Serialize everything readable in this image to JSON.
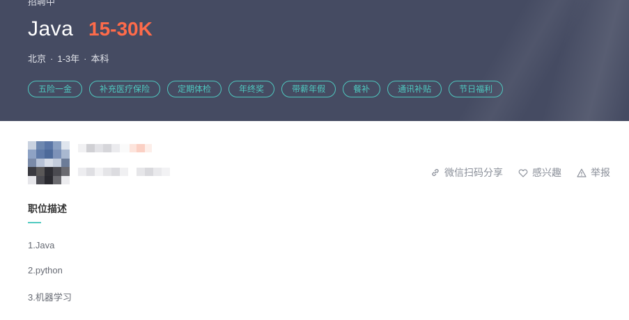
{
  "header": {
    "cut_text": "招聘中",
    "job_title": "Java",
    "salary": "15-30K",
    "location": "北京",
    "experience": "1-3年",
    "education": "本科",
    "tags": [
      "五险一金",
      "补充医疗保险",
      "定期体检",
      "年终奖",
      "带薪年假",
      "餐补",
      "通讯补贴",
      "节日福利"
    ]
  },
  "actions": {
    "share": "微信扫码分享",
    "interested": "感兴趣",
    "report": "举报"
  },
  "description": {
    "title": "职位描述",
    "items": [
      "1.Java",
      "2.python",
      "3.机器学习"
    ]
  },
  "colors": {
    "banner_bg": "#454b62",
    "salary": "#ff6b4a",
    "accent": "#4fc9c0"
  }
}
